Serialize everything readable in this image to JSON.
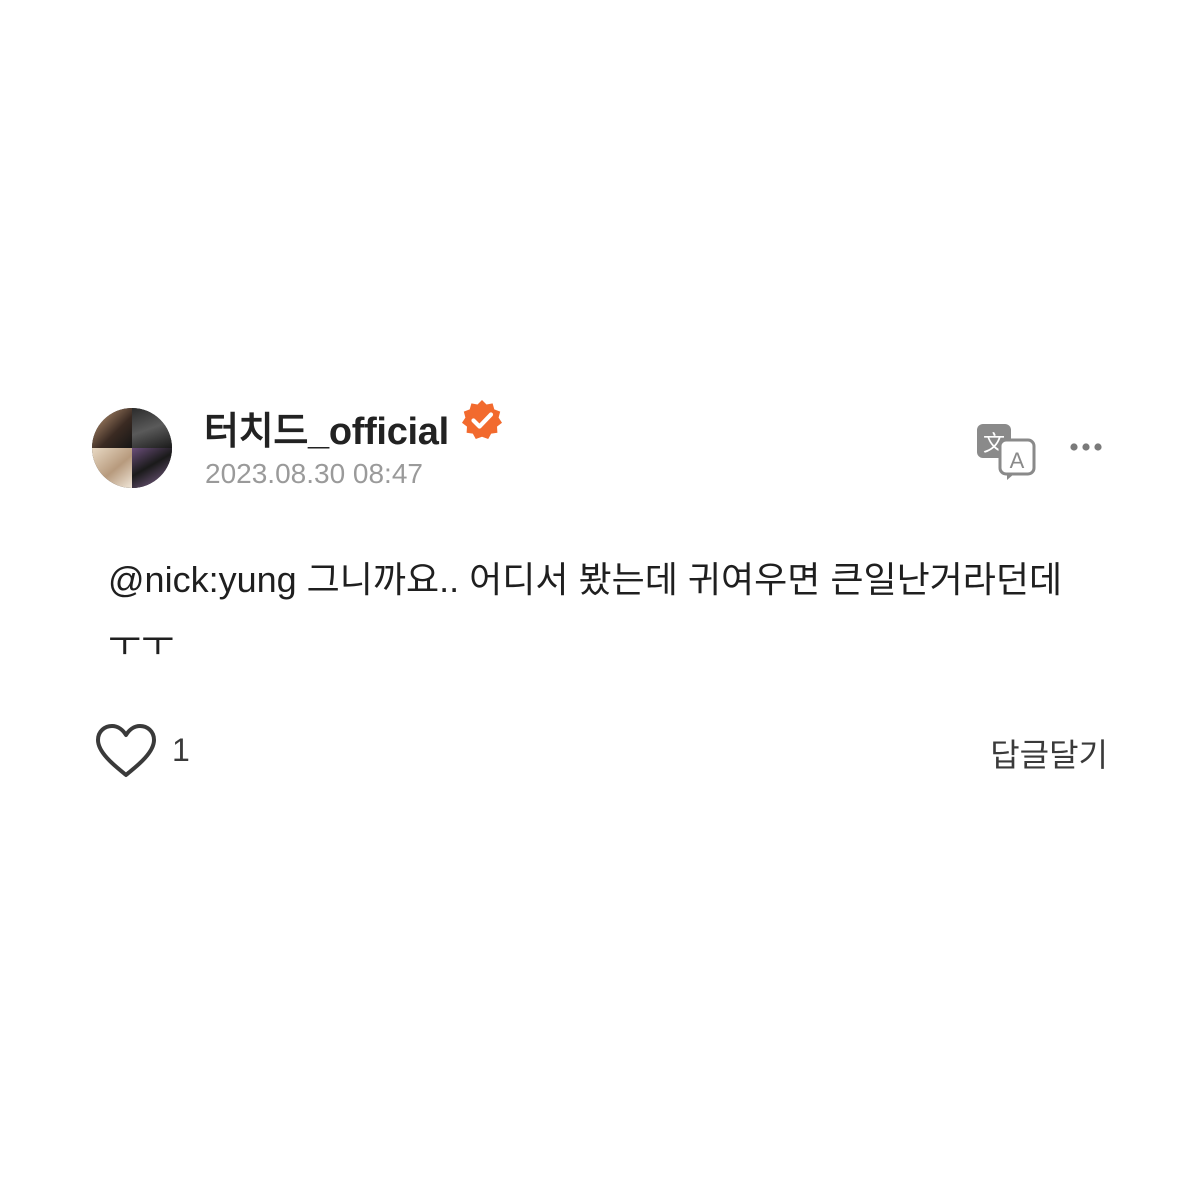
{
  "comment": {
    "author": {
      "name": "터치드_official",
      "verified": true,
      "avatar_icon": "profile-photo-collage"
    },
    "timestamp": "2023.08.30 08:47",
    "text": "@nick:yung 그니까요.. 어디서 봤는데 귀여우면 큰일난거라던데 ㅜㅜ",
    "likes": {
      "count": "1",
      "icon": "heart-outline-icon"
    },
    "reply_label": "답글달기",
    "actions": {
      "translate_icon": "translate-icon",
      "more_icon": "more-horizontal-icon"
    }
  },
  "colors": {
    "verified_badge": "#f26a2e",
    "text_primary": "#1f1f1f",
    "text_secondary": "#9a9a9a",
    "icon": "#3a3a3a"
  }
}
